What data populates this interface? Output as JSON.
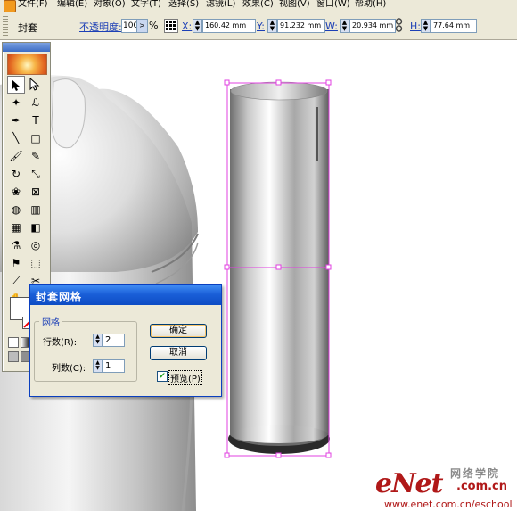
{
  "menubar": {
    "items": [
      "文件(F)",
      "编辑(E)",
      "对象(O)",
      "文字(T)",
      "选择(S)",
      "滤镜(L)",
      "效果(C)",
      "视图(V)",
      "窗口(W)",
      "帮助(H)"
    ]
  },
  "controlbar": {
    "object_type": "封套",
    "opacity_label": "不透明度:",
    "opacity_value": "100",
    "opacity_unit": "%",
    "x_label": "X:",
    "x_value": "160.42 mm",
    "y_label": "Y:",
    "y_value": "91.232 mm",
    "w_label": "W:",
    "w_value": "20.934 mm",
    "h_label": "H:",
    "h_value": "77.64 mm"
  },
  "dialog": {
    "title": "封套网格",
    "group_label": "网格",
    "rows_label": "行数(R):",
    "rows_value": "2",
    "cols_label": "列数(C):",
    "cols_value": "1",
    "ok_label": "确定",
    "cancel_label": "取消",
    "preview_label": "预览(P)",
    "preview_checked": true
  },
  "watermark": {
    "brand": "eNet",
    "cn": "网络学院",
    "domain": ".com.cn",
    "url": "www.enet.com.cn/eschool"
  },
  "colors": {
    "selection": "#e040e0",
    "titlebar": "#0d4cc4",
    "watermark": "#b01818"
  }
}
